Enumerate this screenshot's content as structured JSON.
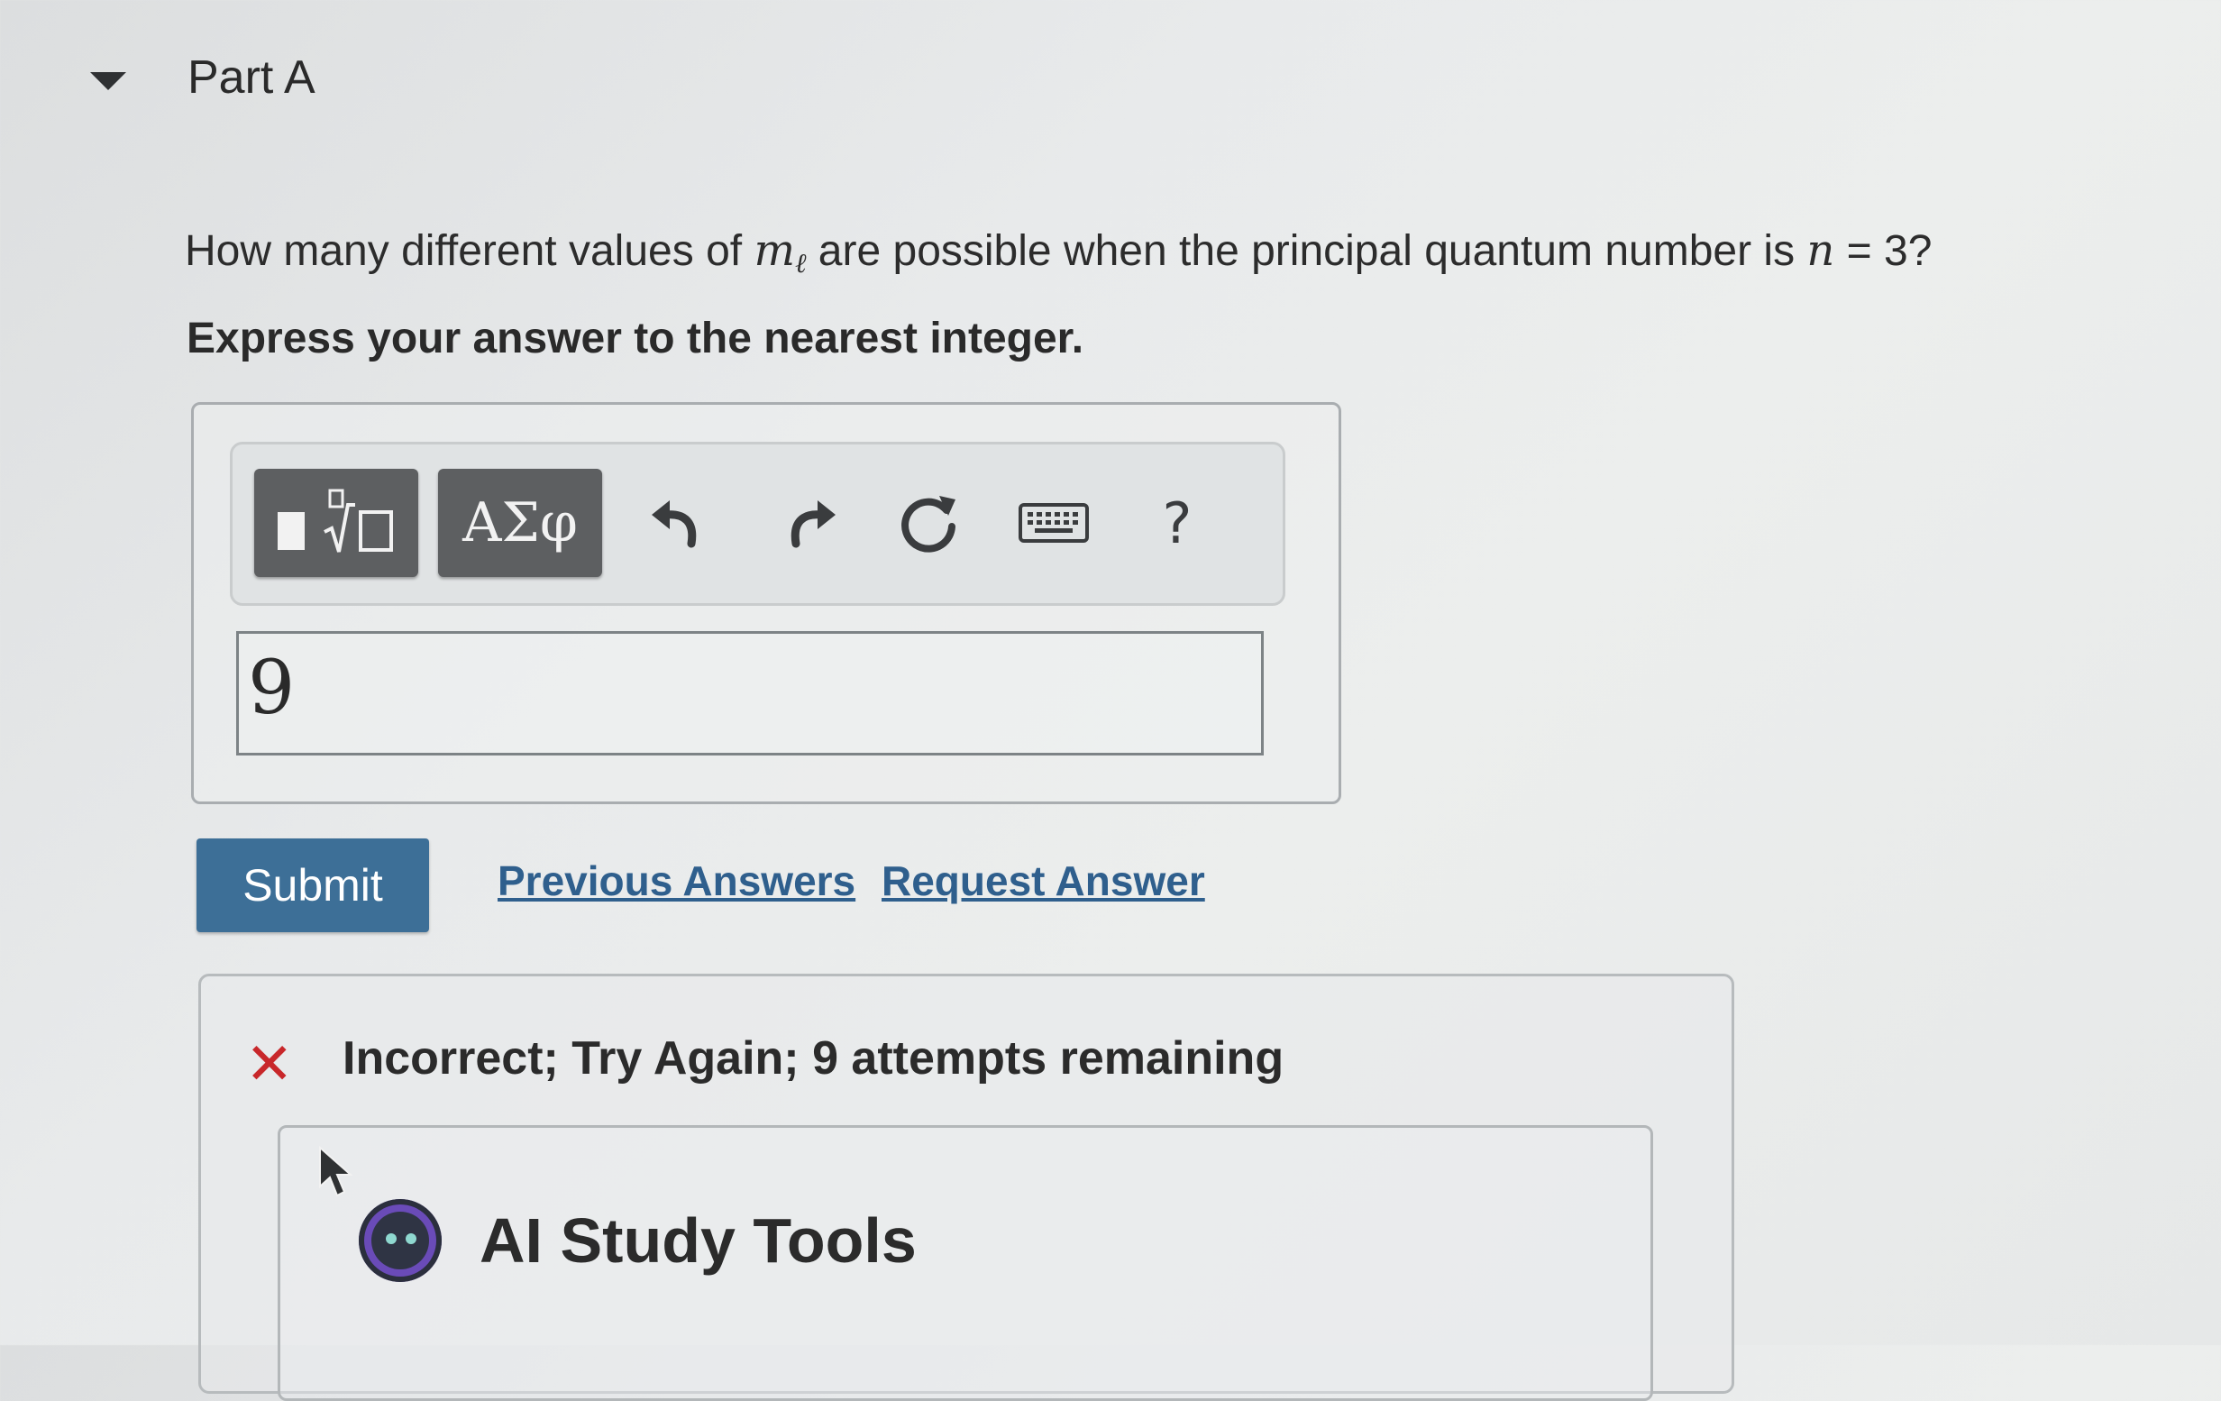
{
  "part": {
    "title": "Part A"
  },
  "question": {
    "prefix": "How many different values of ",
    "variable": "m",
    "variable_subscript": "ℓ",
    "middle": " are possible when the principal quantum number is ",
    "equation_variable": "n",
    "equation_rest": " = 3?",
    "instructions": "Express your answer to the nearest integer."
  },
  "toolbar": {
    "symbols_label": "ΑΣφ",
    "help_label": "?",
    "icons": [
      "templates-icon",
      "undo-icon",
      "redo-icon",
      "reset-icon",
      "keyboard-icon",
      "help-icon"
    ]
  },
  "answer": {
    "value": "9"
  },
  "actions": {
    "submit_label": "Submit",
    "previous_answers_label": "Previous Answers",
    "request_answer_label": "Request Answer"
  },
  "feedback": {
    "icon": "✕",
    "message": "Incorrect; Try Again; 9 attempts remaining",
    "status_color": "#c8272a"
  },
  "ai_tools": {
    "title": "AI Study Tools"
  },
  "colors": {
    "accent": "#3d6f97",
    "link": "#2f5f8d"
  }
}
